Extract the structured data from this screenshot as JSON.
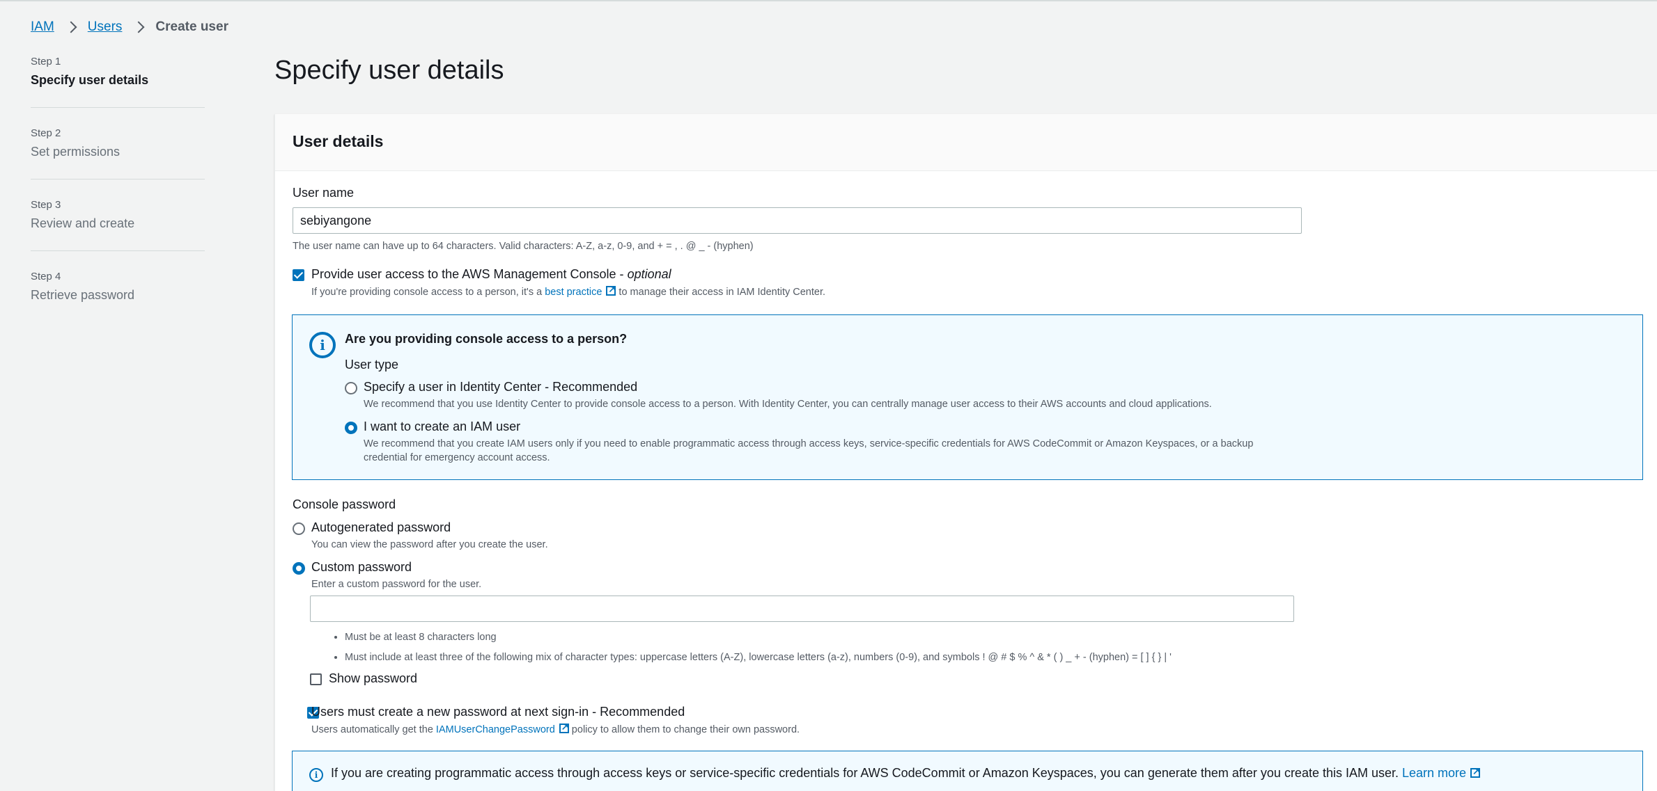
{
  "breadcrumb": {
    "iam": "IAM",
    "users": "Users",
    "current": "Create user"
  },
  "steps": [
    {
      "num": "Step 1",
      "label": "Specify user details"
    },
    {
      "num": "Step 2",
      "label": "Set permissions"
    },
    {
      "num": "Step 3",
      "label": "Review and create"
    },
    {
      "num": "Step 4",
      "label": "Retrieve password"
    }
  ],
  "page_title": "Specify user details",
  "panel": {
    "title": "User details",
    "user_name_label": "User name",
    "user_name_value": "sebiyangone",
    "user_name_hint": "The user name can have up to 64 characters. Valid characters: A-Z, a-z, 0-9, and + = , . @ _ - (hyphen)",
    "console_access_label": "Provide user access to the AWS Management Console - ",
    "console_access_optional": "optional",
    "console_access_hint_pre": "If you're providing console access to a person, it's a ",
    "console_access_hint_link": "best practice",
    "console_access_hint_post": " to manage their access in IAM Identity Center.",
    "info": {
      "heading": "Are you providing console access to a person?",
      "user_type_label": "User type",
      "option1_label": "Specify a user in Identity Center - Recommended",
      "option1_desc": "We recommend that you use Identity Center to provide console access to a person. With Identity Center, you can centrally manage user access to their AWS accounts and cloud applications.",
      "option2_label": "I want to create an IAM user",
      "option2_desc_line1": "We recommend that you create IAM users only if you need to enable programmatic access through access keys, service-specific credentials for AWS CodeCommit or Amazon Keyspaces, or a backup",
      "option2_desc_line2": "credential for emergency account access."
    },
    "console_password_label": "Console password",
    "auto_label": "Autogenerated password",
    "auto_hint": "You can view the password after you create the user.",
    "custom_label": "Custom password",
    "custom_hint": "Enter a custom password for the user.",
    "custom_value": "",
    "rule1": "Must be at least 8 characters long",
    "rule2": "Must include at least three of the following mix of character types: uppercase letters (A-Z), lowercase letters (a-z), numbers (0-9), and symbols ! @ # $ % ^ & * ( ) _ + - (hyphen) = [ ] { } | '",
    "show_password_label": "Show password",
    "new_password_label": "Users must create a new password at next sign-in - Recommended",
    "new_password_hint_pre": "Users automatically get the ",
    "new_password_hint_link": "IAMUserChangePassword",
    "new_password_hint_post": " policy to allow them to change their own password.",
    "bottom_info_text": "If you are creating programmatic access through access keys or service-specific credentials for AWS CodeCommit or Amazon Keyspaces, you can generate them after you create this IAM user. ",
    "bottom_info_link": "Learn more"
  },
  "colors": {
    "accent": "#0073bb",
    "info_bg": "#f1faff",
    "page_bg": "#f2f3f3"
  },
  "icons": [
    "chevron-right-icon",
    "external-link-icon",
    "info-icon",
    "checkbox",
    "radio"
  ]
}
